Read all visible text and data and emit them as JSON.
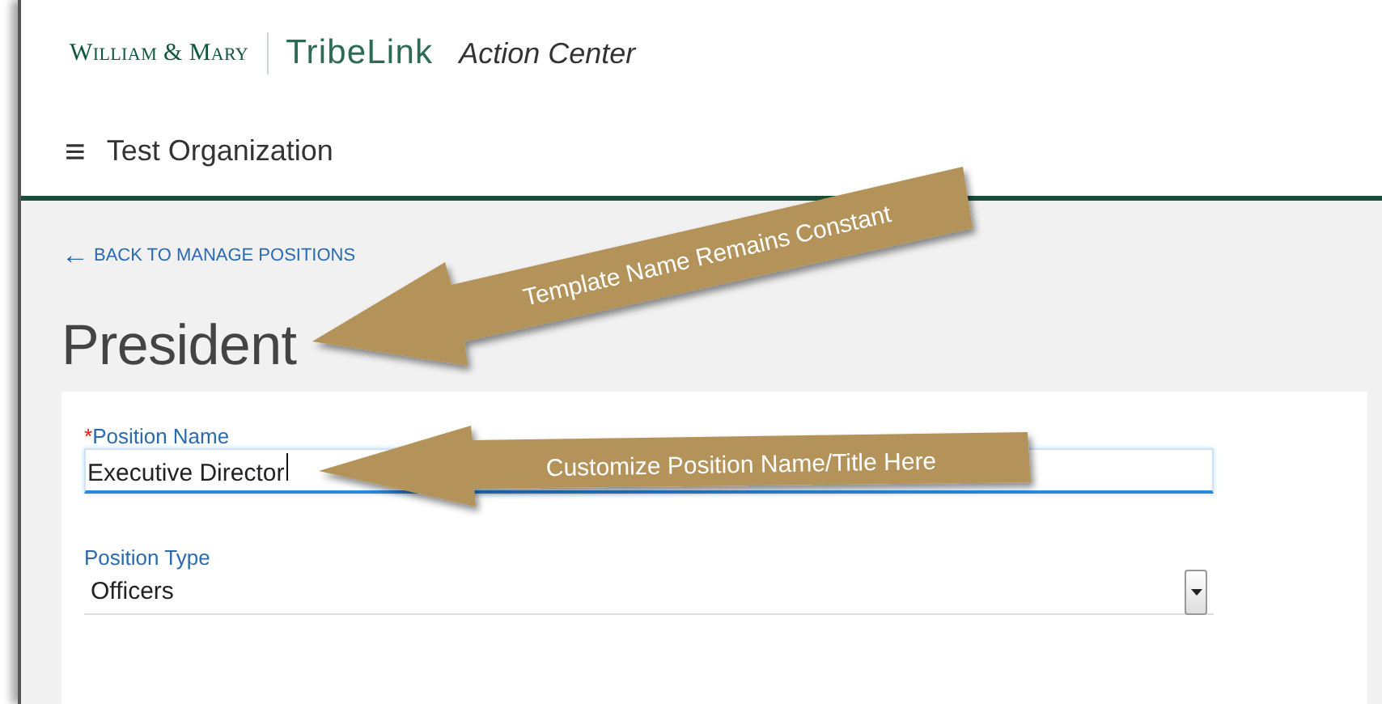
{
  "header": {
    "brand": "William & Mary",
    "product": "TribeLink",
    "section": "Action Center"
  },
  "org_bar": {
    "menu_icon": "≡",
    "organization": "Test Organization"
  },
  "back_link": {
    "arrow": "←",
    "label": "BACK TO MANAGE POSITIONS"
  },
  "page_title": "President",
  "fields": [
    {
      "kind": "text",
      "required_mark": "*",
      "label": "Position Name",
      "value": "Executive Director",
      "focused": true
    },
    {
      "kind": "select",
      "label": "Position Type",
      "value": "Officers",
      "focused": false
    }
  ],
  "callouts": [
    {
      "text": "Template Name Remains Constant"
    },
    {
      "text": "Customize Position Name/Title Here"
    }
  ]
}
